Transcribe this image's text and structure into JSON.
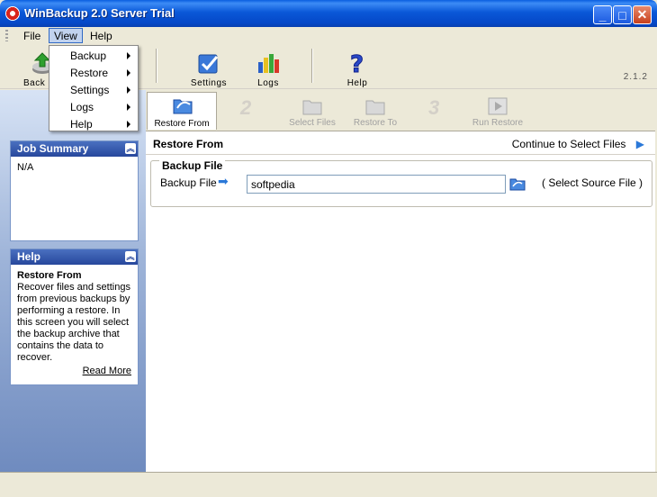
{
  "window": {
    "title": "WinBackup 2.0 Server Trial",
    "minimize": "_",
    "maximize": "□",
    "close": "✕"
  },
  "menubar": {
    "items": [
      {
        "label": "File"
      },
      {
        "label": "View"
      },
      {
        "label": "Help"
      }
    ]
  },
  "view_menu": {
    "items": [
      {
        "label": "Backup",
        "has_submenu": true
      },
      {
        "label": "Restore",
        "has_submenu": true
      },
      {
        "label": "Settings",
        "has_submenu": true
      },
      {
        "label": "Logs",
        "has_submenu": true
      },
      {
        "label": "Help",
        "has_submenu": true
      }
    ]
  },
  "toolbar": {
    "items": [
      {
        "label": "Backup",
        "icon": "backup-icon"
      },
      {
        "label": "Settings",
        "icon": "settings-icon"
      },
      {
        "label": "Logs",
        "icon": "logs-icon"
      },
      {
        "label": "Help",
        "icon": "help-icon"
      }
    ],
    "backup_visible": "Back",
    "version": "2.1.2"
  },
  "sidebar": {
    "job_summary": {
      "title": "Job Summary",
      "content": "N/A"
    },
    "help": {
      "title": "Help",
      "heading": "Restore From",
      "text": "Recover files and settings from previous backups by performing a restore. In this screen you will select the backup archive that contains the data to recover.",
      "read_more": "Read More"
    }
  },
  "wizard": {
    "steps": [
      {
        "num": "",
        "label": "Restore From",
        "active": true
      },
      {
        "num": "2",
        "label": "Select Files",
        "active": false
      },
      {
        "num": "",
        "label": "Restore To",
        "active": false
      },
      {
        "num": "3",
        "label": "Run Restore",
        "active": false
      }
    ]
  },
  "main": {
    "section_title": "Restore From",
    "continue_label": "Continue to Select Files",
    "group_title": "Backup File",
    "field_label": "Backup File",
    "field_value": "softpedia",
    "select_source": "( Select Source File )"
  },
  "colors": {
    "titlebar": "#0548c8",
    "panel_header": "#27479c",
    "accent_arrow": "#2a78d8"
  }
}
